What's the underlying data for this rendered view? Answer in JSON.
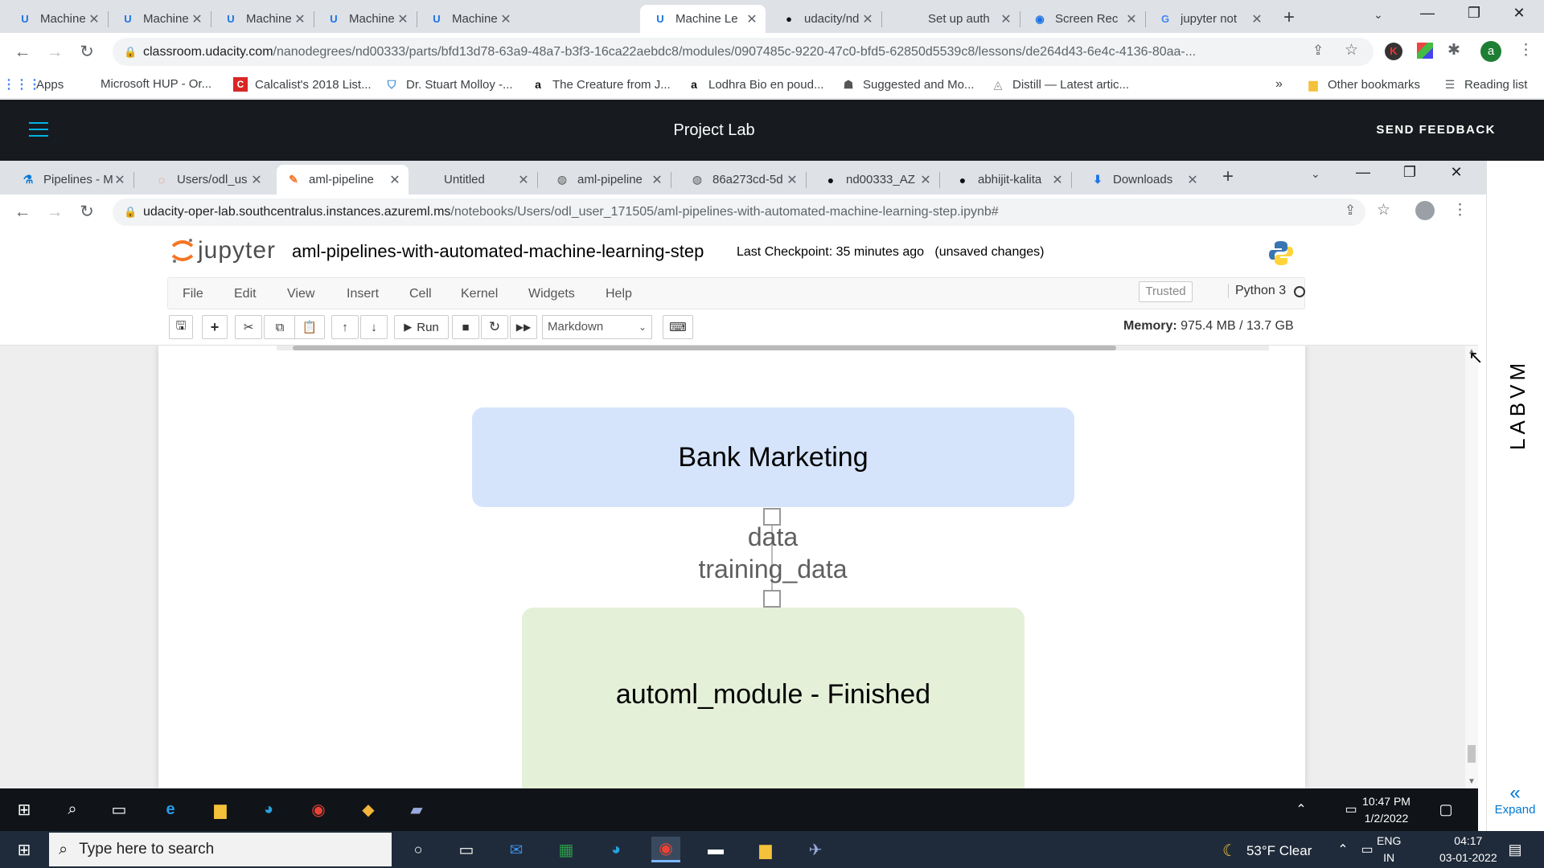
{
  "outer_browser": {
    "tabs": [
      {
        "label": "Machine Le",
        "icon": "udacity-icon"
      },
      {
        "label": "Machine Le",
        "icon": "udacity-icon"
      },
      {
        "label": "Machine Le",
        "icon": "udacity-icon"
      },
      {
        "label": "Machine Le",
        "icon": "udacity-icon"
      },
      {
        "label": "Machine Le",
        "icon": "udacity-icon"
      },
      {
        "label": "Machine Le",
        "icon": "udacity-icon",
        "active": true
      },
      {
        "label": "udacity/nd",
        "icon": "github-icon"
      },
      {
        "label": "Set up auth",
        "icon": "microsoft-icon"
      },
      {
        "label": "Screen Rec",
        "icon": "record-icon"
      },
      {
        "label": "jupyter not",
        "icon": "google-icon"
      }
    ],
    "address": {
      "host": "classroom.udacity.com",
      "path": "/nanodegrees/nd00333/parts/bfd13d78-63a9-48a7-b3f3-16ca22aebdc8/modules/0907485c-9220-47c0-bfd5-62850d5539c8/lessons/de264d43-6e4c-4136-80aa-..."
    },
    "profile_initial": "a",
    "bookmarks": [
      {
        "label": "Apps",
        "icon": "apps-grid-icon"
      },
      {
        "label": "Microsoft HUP - Or...",
        "icon": "microsoft-icon"
      },
      {
        "label": "Calcalist's 2018 List...",
        "icon": "calcalist-icon"
      },
      {
        "label": "Dr. Stuart Molloy -...",
        "icon": "shield-icon"
      },
      {
        "label": "The Creature from J...",
        "icon": "amazon-icon"
      },
      {
        "label": "Lodhra Bio en poud...",
        "icon": "amazon-icon"
      },
      {
        "label": "Suggested and Mo...",
        "icon": "ghost-icon"
      },
      {
        "label": "Distill — Latest artic...",
        "icon": "distill-icon"
      }
    ],
    "other_bookmarks": "Other bookmarks",
    "reading_list": "Reading list"
  },
  "udacity": {
    "title": "Project Lab",
    "feedback": "SEND FEEDBACK"
  },
  "inner_browser": {
    "tabs": [
      {
        "label": "Pipelines - M",
        "icon": "azure-ml-icon"
      },
      {
        "label": "Users/odl_us",
        "icon": "loading-icon"
      },
      {
        "label": "aml-pipeline",
        "icon": "jupyter-icon",
        "active": true
      },
      {
        "label": "Untitled",
        "icon": ""
      },
      {
        "label": "aml-pipeline",
        "icon": "globe-icon"
      },
      {
        "label": "86a273cd-5d",
        "icon": "globe-icon"
      },
      {
        "label": "nd00333_AZ",
        "icon": "github-icon"
      },
      {
        "label": "abhijit-kalita",
        "icon": "github-icon"
      },
      {
        "label": "Downloads",
        "icon": "download-icon"
      }
    ],
    "address": {
      "host": "udacity-oper-lab.southcentralus.instances.azureml.ms",
      "path": "/notebooks/Users/odl_user_171505/aml-pipelines-with-automated-machine-learning-step.ipynb#"
    }
  },
  "jupyter": {
    "logo_text": "jupyter",
    "notebook_title": "aml-pipelines-with-automated-machine-learning-step",
    "checkpoint": "Last Checkpoint: 35 minutes ago",
    "unsaved": "(unsaved changes)",
    "menu": [
      "File",
      "Edit",
      "View",
      "Insert",
      "Cell",
      "Kernel",
      "Widgets",
      "Help"
    ],
    "trusted": "Trusted",
    "kernel": "Python 3",
    "run_label": "Run",
    "cell_type": "Markdown",
    "memory_label": "Memory:",
    "memory_value": "975.4 MB / 13.7 GB"
  },
  "pipeline_graph": {
    "source_node": "Bank Marketing",
    "edge_labels": [
      "data",
      "training_data"
    ],
    "target_node": "automl_module - Finished",
    "colors": {
      "source": "#d6e4fb",
      "target": "#e5f0d9"
    }
  },
  "labvm": {
    "label": "LABVM",
    "expand": "Expand"
  },
  "remote_taskbar": {
    "time": "10:47 PM",
    "date": "1/2/2022"
  },
  "host_taskbar": {
    "search_placeholder": "Type here to search",
    "weather": "53°F  Clear",
    "lang_top": "ENG",
    "lang_bottom": "IN",
    "time": "04:17",
    "date": "03-01-2022"
  }
}
